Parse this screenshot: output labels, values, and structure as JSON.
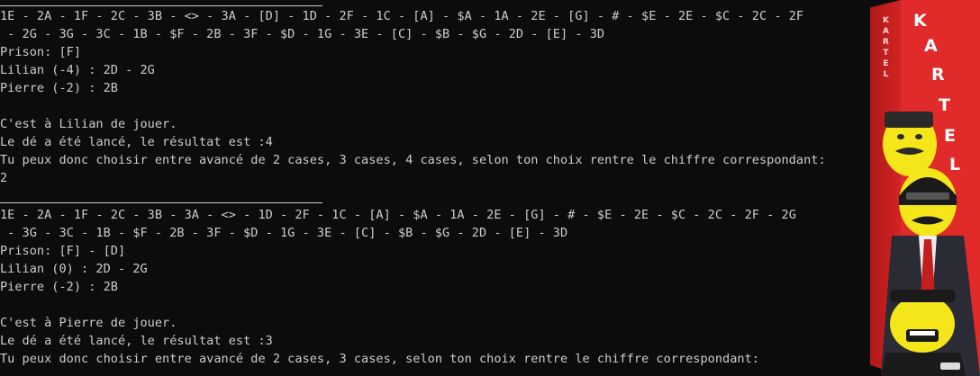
{
  "terminal": {
    "lines": [
      "1E - 2A - 1F - 2C - 3B - <> - 3A - [D] - 1D - 2F - 1C - [A] - $A - 1A - 2E - [G] - # - $E - 2E - $C - 2C - 2F",
      " - 2G - 3G - 3C - 1B - $F - 2B - 3F - $D - 1G - 3E - [C] - $B - $G - 2D - [E] - 3D",
      "Prison: [F]",
      "Lilian (-4) : 2D - 2G",
      "Pierre (-2) : 2B",
      "",
      "C'est à Lilian de jouer.",
      "Le dé a été lancé, le résultat est :4",
      "Tu peux donc choisir entre avancé de 2 cases, 3 cases, 4 cases, selon ton choix rentre le chiffre correspondant:",
      "2",
      "1E - 2A - 1F - 2C - 3B - 3A - <> - 1D - 2F - 1C - [A] - $A - 1A - 2E - [G] - # - $E - 2E - $C - 2C - 2F - 2G",
      " - 3G - 3C - 1B - $F - 2B - 3F - $D - 1G - 3E - [C] - $B - $G - 2D - [E] - 3D",
      "Prison: [F] - [D]",
      "Lilian (0) : 2D - 2G",
      "Pierre (-2) : 2B",
      "",
      "C'est à Pierre de jouer.",
      "Le dé a été lancé, le résultat est :3",
      "Tu peux donc choisir entre avancé de 2 cases, 3 cases, selon ton choix rentre le chiffre correspondant:"
    ]
  },
  "boxart": {
    "side_title": "KARTEL",
    "front_title": "KARTEL"
  },
  "colors": {
    "background": "#0c0c0c",
    "text": "#cccccc",
    "box_red": "#e12a2a",
    "figure_yellow": "#f5e61a",
    "suit_black": "#1a1a1a"
  }
}
